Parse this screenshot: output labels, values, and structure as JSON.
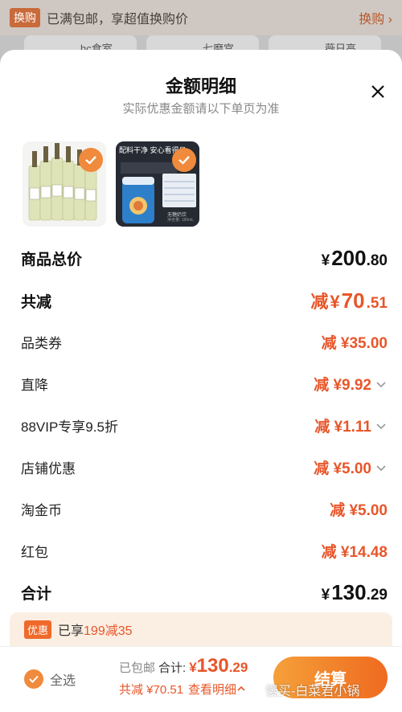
{
  "background": {
    "banner_tag": "换购",
    "banner_text": "已满包邮，享超值换购价",
    "banner_link": "换购",
    "items": [
      "hc食室",
      "七磨宫",
      "薇日高"
    ]
  },
  "sheet": {
    "title": "金额明细",
    "subtitle": "实际优惠金额请以下单页为准"
  },
  "products": [
    {
      "name": "wine-bottles",
      "selected": true
    },
    {
      "name": "milk-powder-can",
      "selected": true,
      "overlay_text": "配料干净 安心看得见",
      "label_text": "无糖奶饮",
      "net_text": "净含量: 180mL"
    }
  ],
  "rows": {
    "goods_total": {
      "label": "商品总价",
      "yen": "¥",
      "int": "200",
      "dec": ".80"
    },
    "total_reduce": {
      "label": "共减",
      "prefix": "减",
      "yen": "¥",
      "int": "70",
      "dec": ".51"
    },
    "category_coupon": {
      "label": "品类券",
      "value": "减 ¥35.00"
    },
    "direct_drop": {
      "label": "直降",
      "value": "减 ¥9.92"
    },
    "vip": {
      "label": "88VIP专享9.5折",
      "value": "减 ¥1.11"
    },
    "store_discount": {
      "label": "店铺优惠",
      "value": "减 ¥5.00"
    },
    "taojinbi": {
      "label": "淘金币",
      "value": "减 ¥5.00"
    },
    "red_packet": {
      "label": "红包",
      "value": "减 ¥14.48"
    },
    "sum_total": {
      "label": "合计",
      "yen": "¥",
      "int": "130",
      "dec": ".29"
    }
  },
  "promo": {
    "tag": "优惠",
    "text_prefix": "已享",
    "text_highlight": "199减35"
  },
  "bottom": {
    "select_all": "全选",
    "shipping": "已包邮",
    "sum_label": "合计:",
    "sum_yen": "¥",
    "sum_int": "130",
    "sum_dec": ".29",
    "reduce_text": "共减 ¥70.51",
    "detail_link": "查看明细",
    "checkout": "结算"
  },
  "watermark": "慢买-白菜君小锅",
  "colors": {
    "accent": "#e8562a",
    "badge": "#f08a3c",
    "checkout_start": "#f5a03a",
    "checkout_end": "#ef6a1f"
  }
}
